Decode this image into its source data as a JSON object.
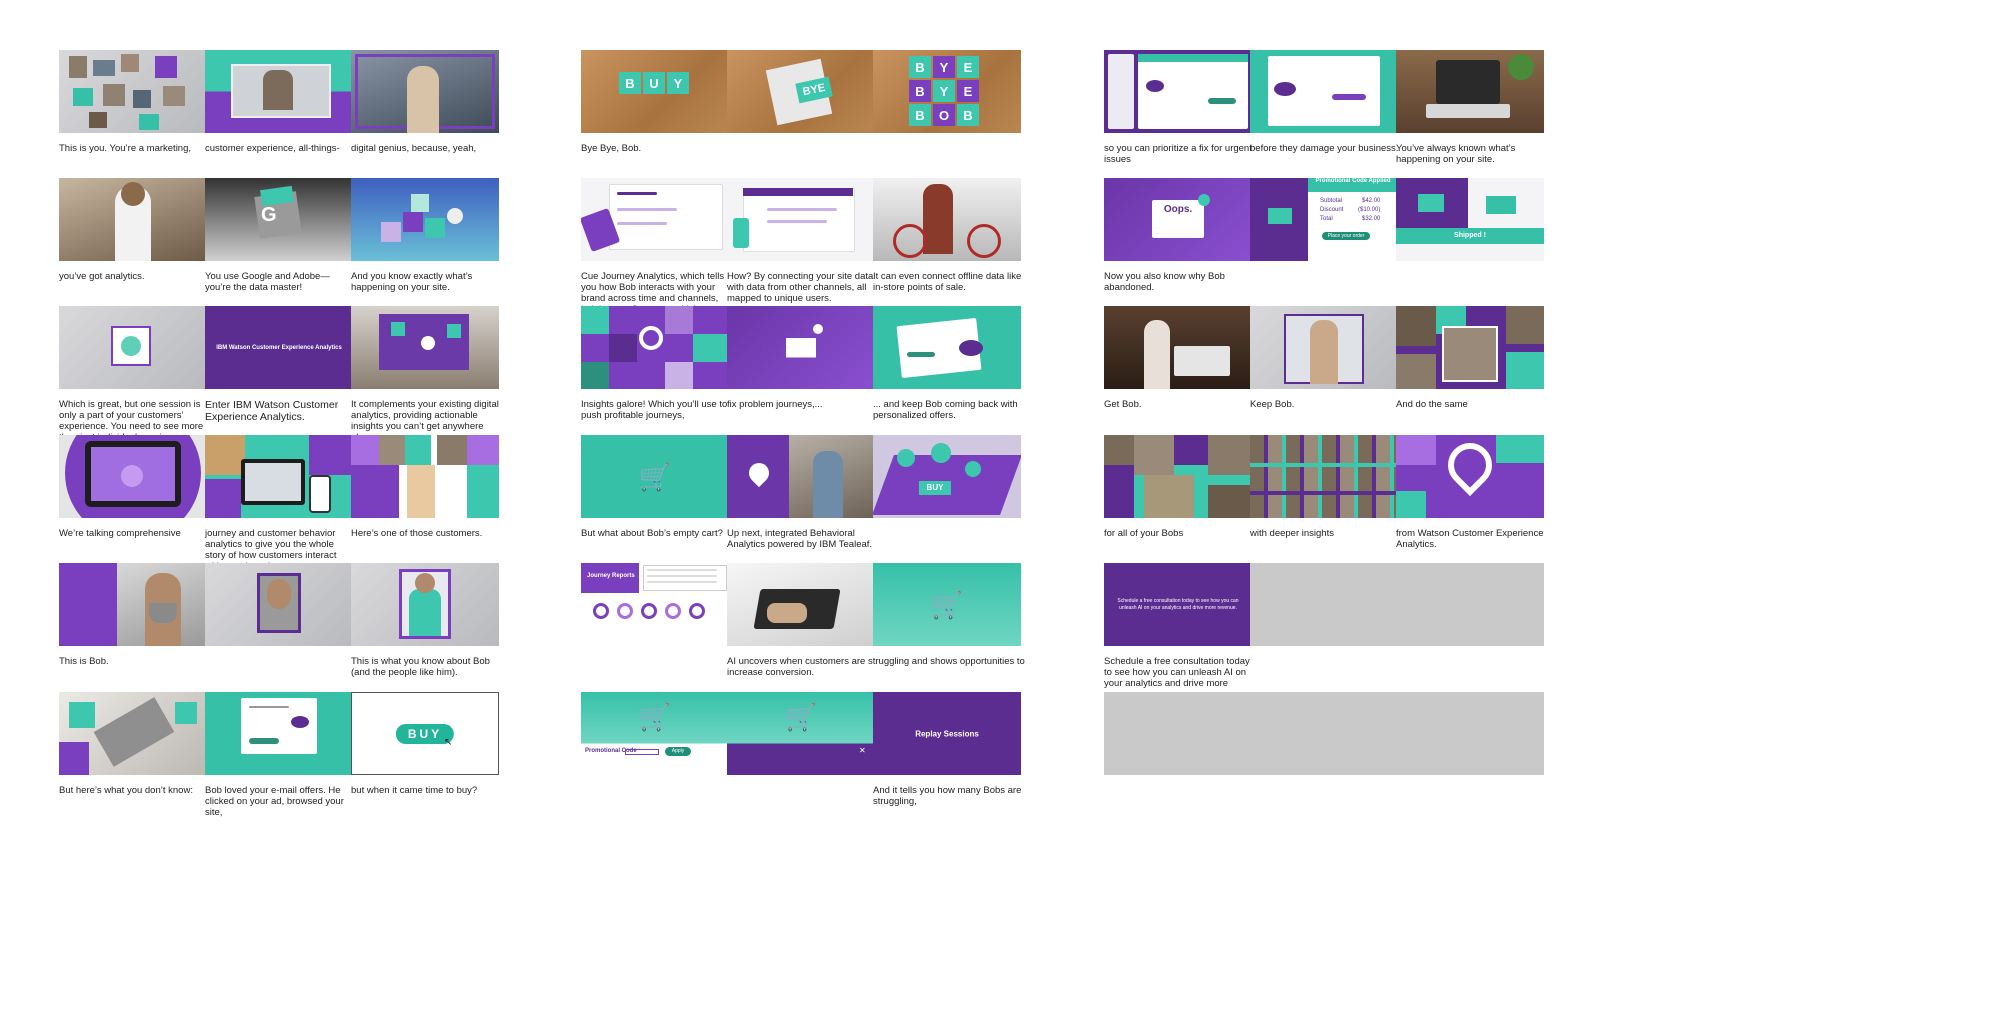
{
  "frames": [
    {
      "caption": "This is you. You’re a marketing,"
    },
    {
      "caption": "customer experience, all-things-"
    },
    {
      "caption": "digital genius, because, yeah,"
    },
    {
      "caption": "Bye Bye, Bob."
    },
    {
      "caption": ""
    },
    {
      "caption": ""
    },
    {
      "caption": "so you can prioritize a fix for urgent issues"
    },
    {
      "caption": "before they damage your business."
    },
    {
      "caption": "You’ve always known what’s happening on your site."
    },
    {
      "caption": "you’ve got analytics."
    },
    {
      "caption": "You use Google and Adobe—you’re the data master!"
    },
    {
      "caption": "And you know exactly what’s happening on your site."
    },
    {
      "caption": "Cue Journey Analytics, which tells you how Bob interacts with your brand across time and channels, helping you figure out which journeys work and which don’t."
    },
    {
      "caption": "How? By connecting your site data with data from other channels, all mapped to unique users."
    },
    {
      "caption": "It can even connect offline data like in-store points of sale."
    },
    {
      "caption": "Now you also know why Bob abandoned."
    },
    {
      "caption": ""
    },
    {
      "caption": ""
    },
    {
      "caption": "Which is great, but one session is only a part of your customers’ experience. You need to see more than just individual sessions."
    },
    {
      "caption": "Enter IBM Watson Customer Experience Analytics."
    },
    {
      "caption": "It complements your existing digital analytics, providing actionable insights you can’t get anywhere else."
    },
    {
      "caption": "Insights galore! Which you’ll use to push profitable journeys,"
    },
    {
      "caption": "fix problem journeys,..."
    },
    {
      "caption": "... and keep Bob coming back with personalized offers."
    },
    {
      "caption": "Get Bob."
    },
    {
      "caption": "Keep Bob."
    },
    {
      "caption": "And do the same"
    },
    {
      "caption": "We’re talking comprehensive"
    },
    {
      "caption": "journey and customer behavior analytics to give you the whole story of how customers interact with your brand."
    },
    {
      "caption": "Here’s one of those customers."
    },
    {
      "caption": "But what about Bob’s empty cart?"
    },
    {
      "caption": "Up next, integrated Behavioral Analytics powered by IBM Tealeaf."
    },
    {
      "caption": ""
    },
    {
      "caption": "for all of your Bobs"
    },
    {
      "caption": "with deeper insights"
    },
    {
      "caption": "from Watson Customer Experience Analytics."
    },
    {
      "caption": "This is Bob."
    },
    {
      "caption": ""
    },
    {
      "caption": "This is what you know about Bob (and the people like him)."
    },
    {
      "caption": ""
    },
    {
      "caption": "AI uncovers when customers are struggling and shows opportunities to increase conversion."
    },
    {
      "caption": ""
    },
    {
      "caption": "Schedule a free consultation today to see how you can unleash AI on your analytics and drive more revenue."
    },
    {
      "caption": ""
    },
    {
      "caption": ""
    },
    {
      "caption": "But here’s what you don’t know:"
    },
    {
      "caption": "Bob loved your e-mail offers. He clicked on your ad, browsed your site,"
    },
    {
      "caption": "but when it came time to buy?"
    },
    {
      "caption": ""
    },
    {
      "caption": ""
    },
    {
      "caption": "And it tells you how many Bobs are struggling,"
    },
    {
      "caption": ""
    },
    {
      "caption": ""
    },
    {
      "caption": ""
    }
  ],
  "thumb_text": {
    "ibm_title": "IBM Watson Customer Experience Analytics",
    "buy": "BUY",
    "bye": "BYE",
    "bob": "BOB",
    "promo_title": "Promotional Code Applied",
    "subtotal_label": "Subtotal",
    "subtotal_value": "$42.00",
    "discount_label": "Discount",
    "discount_value": "($10.00)",
    "total_label": "Total",
    "total_value": "$32.00",
    "place_order": "Place your order",
    "shipped": "Shipped !",
    "journey_reports": "Journey Reports",
    "promo_code_label": "Promotional Code",
    "apply": "Apply",
    "replay_sessions": "Replay Sessions",
    "consult_text": "Schedule a free consultation today to see how you can unleash AI on your analytics and drive more revenue.",
    "oops": "Oops."
  },
  "colors": {
    "purple": "#5b2d91",
    "teal": "#36c0a8"
  }
}
